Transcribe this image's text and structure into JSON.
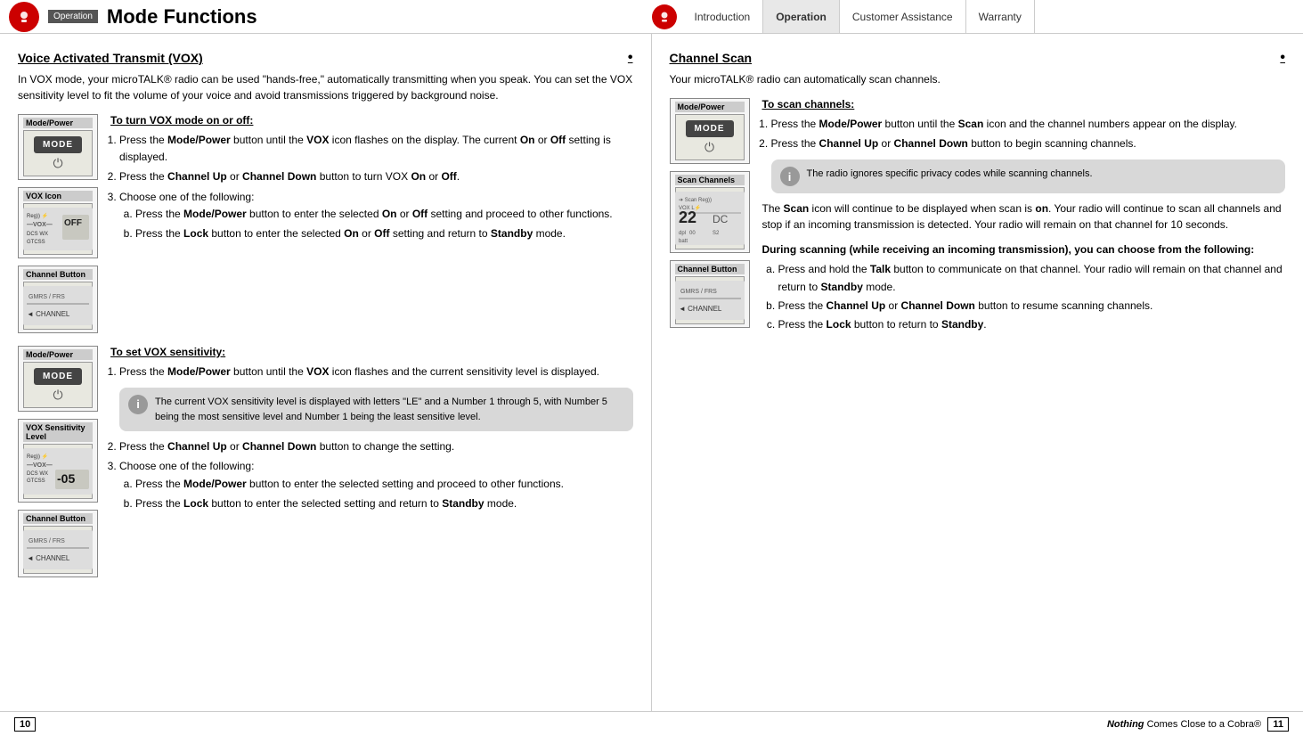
{
  "topNav": {
    "logoSymbol": "◉",
    "pageTitle": "Mode Functions",
    "operationBadge": "Operation",
    "tabs": [
      {
        "label": "Introduction",
        "active": false
      },
      {
        "label": "Operation",
        "active": true
      },
      {
        "label": "Customer Assistance",
        "active": false
      },
      {
        "label": "Warranty",
        "active": false
      }
    ]
  },
  "leftSection": {
    "heading": "Voice Activated Transmit (VOX)",
    "intro": "In VOX mode, your microTALK® radio can be used \"hands-free,\" automatically transmitting when you speak. You can set the VOX sensitivity level to fit the volume of your voice and avoid transmissions triggered by background noise.",
    "subHeading1": "To turn VOX mode on or off:",
    "steps1": [
      "Press the Mode/Power button until the VOX icon flashes on the display. The current On or Off setting is displayed.",
      "Press the Channel Up or Channel Down button to turn VOX On or Off.",
      "Choose one of the following:"
    ],
    "steps1sub": [
      "Press the Mode/Power button to enter the selected On or Off setting and proceed to other functions.",
      "Press the Lock button to enter the selected On or Off setting and return to Standby mode."
    ],
    "subHeading2": "To set VOX sensitivity:",
    "steps2": [
      "Press the Mode/Power button until the VOX icon flashes and the current sensitivity level is displayed."
    ],
    "callout1": "The current VOX sensitivity level is displayed with letters \"LE\" and a Number 1 through 5, with Number 5 being the most sensitive level and Number 1 being the least sensitive level.",
    "steps2cont": [
      "Press the Channel Up or Channel Down button to change the setting.",
      "Choose one of the following:"
    ],
    "steps2sub": [
      "Press the Mode/Power button to enter the selected setting and proceed to other functions.",
      "Press the Lock button to enter the selected setting and return to Standby mode."
    ],
    "deviceLabels": {
      "modePower": "Mode/Power",
      "voxIcon": "VOX  Icon",
      "channelButton": "Channel Button",
      "modePower2": "Mode/Power",
      "voxSensitivity": "VOX Sensitivity Level",
      "channelButton2": "Channel Button"
    }
  },
  "rightSection": {
    "heading": "Channel Scan",
    "intro": "Your microTALK® radio can automatically scan channels.",
    "subHeading": "To scan channels:",
    "steps": [
      "Press the Mode/Power button until the Scan icon and the channel numbers appear on the display.",
      "Press the Channel Up or Channel Down button to begin scanning channels."
    ],
    "callout": "The radio ignores specific privacy codes while scanning channels.",
    "scanDescription": "The Scan icon will continue to be displayed when scan is on. Your radio will continue to scan all channels and stop if an incoming transmission is detected. Your radio will remain on that channel for 10 seconds.",
    "duringScanning": "During scanning (while receiving an incoming transmission), you can choose from the following:",
    "duringSteps": [
      "Press and hold the Talk button to communicate on that channel. Your radio will remain on that channel and return to Standby mode.",
      "Press the Channel Up or Channel Down button to resume scanning channels.",
      "Press the Lock button to return to Standby."
    ],
    "deviceLabels": {
      "modePower": "Mode/Power",
      "scanChannels": "Scan Channels",
      "channelButton": "Channel Button"
    }
  },
  "footer": {
    "pageLeft": "10",
    "taglineNormal": "Nothing",
    "taglineItalic": " Comes Close to a Cobra®",
    "pageRight": "11"
  }
}
